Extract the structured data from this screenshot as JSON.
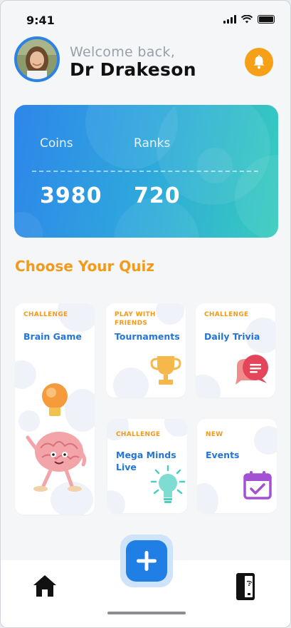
{
  "status_bar": {
    "time": "9:41"
  },
  "header": {
    "greeting": "Welcome back,",
    "username": "Dr Drakeson"
  },
  "stats": {
    "coins_label": "Coins",
    "coins_value": "3980",
    "ranks_label": "Ranks",
    "ranks_value": "720"
  },
  "section_title": "Choose Your Quiz",
  "quizzes": [
    {
      "tag": "CHALLENGE",
      "title": "Brain Game",
      "icon": "brain-with-bulb-icon"
    },
    {
      "tag": "PLAY WITH\nFRIENDS",
      "title": "Tournaments",
      "icon": "trophy-icon"
    },
    {
      "tag": "CHALLENGE",
      "title": "Daily Trivia",
      "icon": "chat-bubbles-icon"
    },
    {
      "tag": "CHALLENGE",
      "title": "Mega Minds\nLive",
      "icon": "lightbulb-icon"
    },
    {
      "tag": "NEW",
      "title": "Events",
      "icon": "calendar-check-icon"
    }
  ],
  "colors": {
    "accent_orange": "#f39a1b",
    "accent_blue": "#1f7fe5",
    "card_gradient": [
      "#2e86ea",
      "#37ccbd"
    ]
  },
  "nav": {
    "items": [
      "home-icon",
      "add-icon",
      "phone-wifi-icon"
    ]
  }
}
